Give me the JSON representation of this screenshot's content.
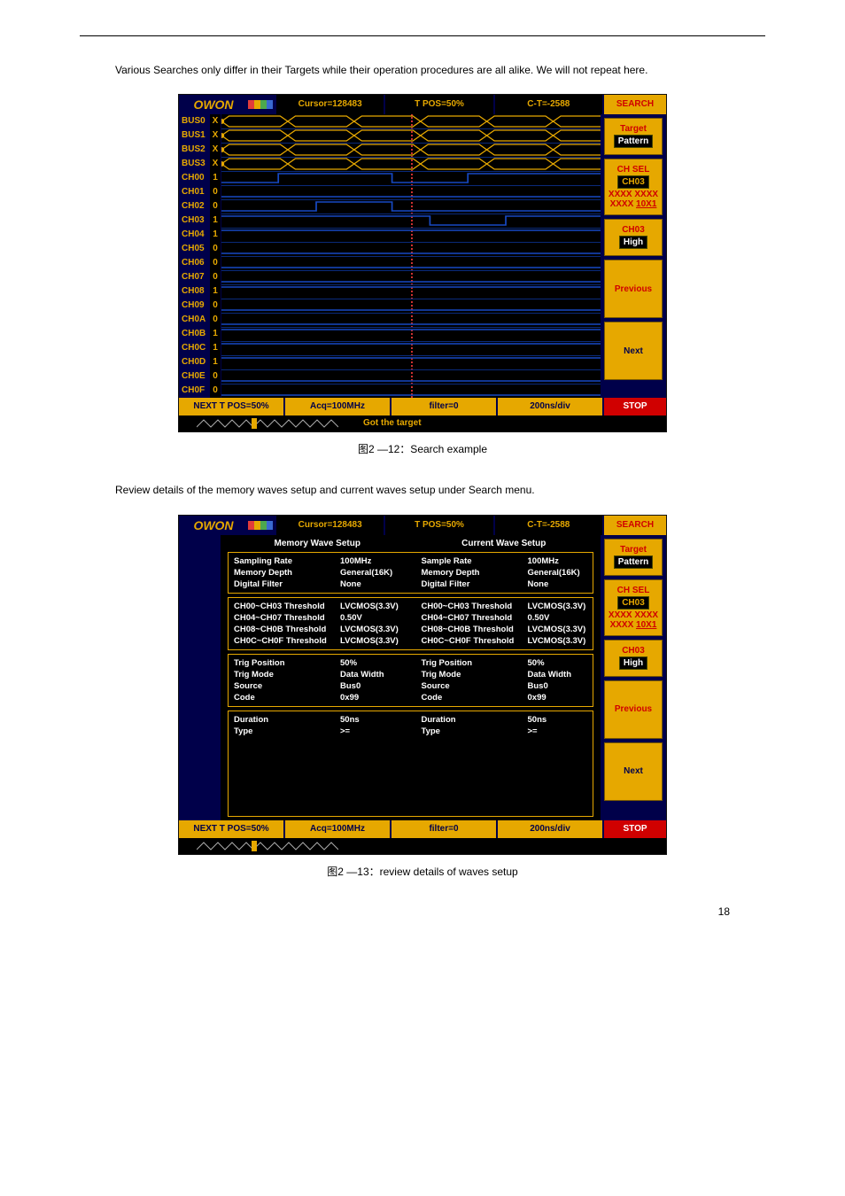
{
  "doc": {
    "text_above": "Various Searches only differ in their Targets while their operation procedures are all alike. We will not repeat here."
  },
  "captions": {
    "fig1": "图2 —12：Search example",
    "intro2": "Review details of the memory waves setup and current waves setup under Search menu.",
    "fig2": "图2 —13：review details of waves setup"
  },
  "page_number": "18",
  "scr1": {
    "brand": "OWON",
    "titlebar": {
      "cursor": "Cursor=128483",
      "tpos": "T POS=50%",
      "ct": "C-T=-2588",
      "search": "SEARCH"
    },
    "rows": [
      {
        "label": "BUS0",
        "val": "X"
      },
      {
        "label": "BUS1",
        "val": "X"
      },
      {
        "label": "BUS2",
        "val": "X"
      },
      {
        "label": "BUS3",
        "val": "X"
      },
      {
        "label": "CH00",
        "val": "1"
      },
      {
        "label": "CH01",
        "val": "0"
      },
      {
        "label": "CH02",
        "val": "0"
      },
      {
        "label": "CH03",
        "val": "1"
      },
      {
        "label": "CH04",
        "val": "1"
      },
      {
        "label": "CH05",
        "val": "0"
      },
      {
        "label": "CH06",
        "val": "0"
      },
      {
        "label": "CH07",
        "val": "0"
      },
      {
        "label": "CH08",
        "val": "1"
      },
      {
        "label": "CH09",
        "val": "0"
      },
      {
        "label": "CH0A",
        "val": "0"
      },
      {
        "label": "CH0B",
        "val": "1"
      },
      {
        "label": "CH0C",
        "val": "1"
      },
      {
        "label": "CH0D",
        "val": "1"
      },
      {
        "label": "CH0E",
        "val": "0"
      },
      {
        "label": "CH0F",
        "val": "0"
      }
    ],
    "side": {
      "target_label": "Target",
      "target_chip": "Pattern",
      "chsel_label": "CH SEL",
      "chsel_chip": "CH03",
      "pattern1": "XXXX XXXX",
      "pattern2_a": "XXXX ",
      "pattern2_b": "10X1",
      "ch03_label": "CH03",
      "ch03_chip": "High",
      "previous": "Previous",
      "next": "Next"
    },
    "statusbar": {
      "a": "NEXT T POS=50%",
      "b": "Acq=100MHz",
      "c": "filter=0",
      "d": "200ns/div",
      "stop": "STOP"
    },
    "minibar_text": "Got the target"
  },
  "scr2": {
    "brand": "OWON",
    "titlebar": {
      "cursor": "Cursor=128483",
      "tpos": "T POS=50%",
      "ct": "C-T=-2588",
      "search": "SEARCH"
    },
    "mem_title": "Memory Wave Setup",
    "cur_title": "Current Wave Setup",
    "box1": {
      "left": [
        {
          "k": "Sampling Rate",
          "v": "100MHz"
        },
        {
          "k": "Memory Depth",
          "v": "General(16K)"
        },
        {
          "k": "Digital Filter",
          "v": "None"
        }
      ],
      "right": [
        {
          "k": "Sample Rate",
          "v": "100MHz"
        },
        {
          "k": "Memory Depth",
          "v": "General(16K)"
        },
        {
          "k": "Digital Filter",
          "v": "None"
        }
      ]
    },
    "box2": {
      "left": [
        {
          "k": "CH00~CH03 Threshold",
          "v": "LVCMOS(3.3V)"
        },
        {
          "k": "CH04~CH07 Threshold",
          "v": "0.50V"
        },
        {
          "k": "CH08~CH0B Threshold",
          "v": "LVCMOS(3.3V)"
        },
        {
          "k": "CH0C~CH0F Threshold",
          "v": "LVCMOS(3.3V)"
        }
      ],
      "right": [
        {
          "k": "CH00~CH03 Threshold",
          "v": "LVCMOS(3.3V)"
        },
        {
          "k": "CH04~CH07 Threshold",
          "v": "0.50V"
        },
        {
          "k": "CH08~CH0B Threshold",
          "v": "LVCMOS(3.3V)"
        },
        {
          "k": "CH0C~CH0F Threshold",
          "v": "LVCMOS(3.3V)"
        }
      ]
    },
    "box3": {
      "left": [
        {
          "k": "Trig Position",
          "v": "50%"
        },
        {
          "k": "Trig Mode",
          "v": "Data Width"
        },
        {
          "k": "Source",
          "v": "Bus0"
        },
        {
          "k": "Code",
          "v": "0x99"
        }
      ],
      "right": [
        {
          "k": "Trig Position",
          "v": "50%"
        },
        {
          "k": "Trig Mode",
          "v": "Data Width"
        },
        {
          "k": "Source",
          "v": "Bus0"
        },
        {
          "k": "Code",
          "v": "0x99"
        }
      ]
    },
    "box4": {
      "left": [
        {
          "k": "Duration",
          "v": "50ns"
        },
        {
          "k": "Type",
          "v": ">="
        }
      ],
      "right": [
        {
          "k": "Duration",
          "v": "50ns"
        },
        {
          "k": "Type",
          "v": ">="
        }
      ]
    },
    "side": {
      "target_label": "Target",
      "target_chip": "Pattern",
      "chsel_label": "CH SEL",
      "chsel_chip": "CH03",
      "pattern1": "XXXX XXXX",
      "pattern2_a": "XXXX ",
      "pattern2_b": "10X1",
      "ch03_label": "CH03",
      "ch03_chip": "High",
      "previous": "Previous",
      "next": "Next"
    },
    "statusbar": {
      "a": "NEXT T POS=50%",
      "b": "Acq=100MHz",
      "c": "filter=0",
      "d": "200ns/div",
      "stop": "STOP"
    }
  }
}
